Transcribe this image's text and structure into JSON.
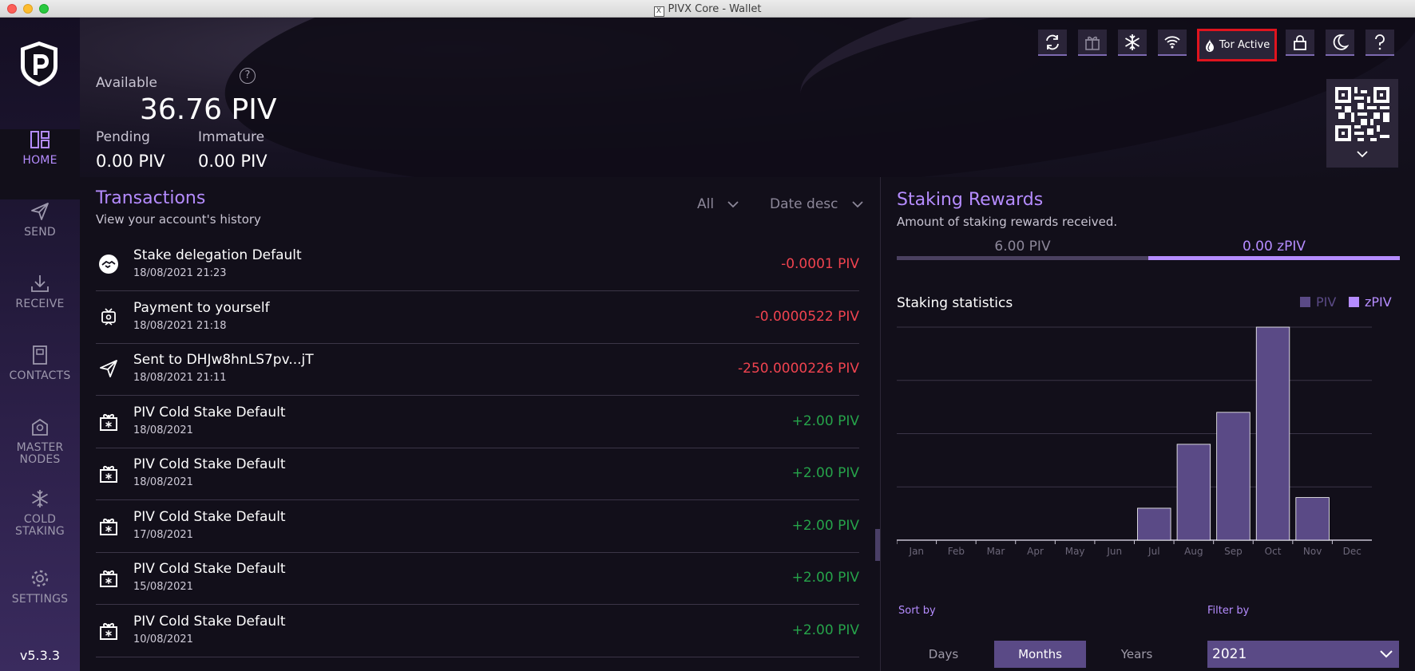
{
  "window": {
    "title": "PIVX Core - Wallet"
  },
  "sidebar": {
    "items": [
      {
        "label": "HOME",
        "icon": "dashboard-icon"
      },
      {
        "label": "SEND",
        "icon": "send-icon"
      },
      {
        "label": "RECEIVE",
        "icon": "download-icon"
      },
      {
        "label": "CONTACTS",
        "icon": "address-book-icon"
      },
      {
        "label": "MASTER\nNODES",
        "icon": "masternode-icon"
      },
      {
        "label": "COLD\nSTAKING",
        "icon": "snowflake-icon"
      },
      {
        "label": "SETTINGS",
        "icon": "gear-icon"
      }
    ],
    "version": "v5.3.3"
  },
  "balance": {
    "available_label": "Available",
    "available_value": "36.76  PIV",
    "pending_label": "Pending",
    "pending_value": "0.00 PIV",
    "immature_label": "Immature",
    "immature_value": "0.00 PIV"
  },
  "toolbar": {
    "tor_label": "Tor Active",
    "buttons": [
      "sync-icon",
      "gift-icon",
      "snowflake-icon",
      "wifi-icon",
      "tor-icon",
      "lock-icon",
      "moon-icon",
      "help-icon"
    ]
  },
  "transactions": {
    "title": "Transactions",
    "subtitle": "View your account's history",
    "filter_type": "All",
    "filter_sort": "Date desc",
    "rows": [
      {
        "title": "Stake delegation Default",
        "date": "18/08/2021 21:23",
        "amount": "-0.0001 PIV",
        "kind": "neg",
        "icon": "handshake"
      },
      {
        "title": "Payment to yourself",
        "date": "18/08/2021 21:18",
        "amount": "-0.0000522 PIV",
        "kind": "neg",
        "icon": "self"
      },
      {
        "title": "Sent to DHJw8hnLS7pv...jT",
        "date": "18/08/2021 21:11",
        "amount": "-250.0000226 PIV",
        "kind": "neg",
        "icon": "send"
      },
      {
        "title": "PIV Cold Stake Default",
        "date": "18/08/2021",
        "amount": "+2.00 PIV",
        "kind": "pos",
        "icon": "gift"
      },
      {
        "title": "PIV Cold Stake Default",
        "date": "18/08/2021",
        "amount": "+2.00 PIV",
        "kind": "pos",
        "icon": "gift"
      },
      {
        "title": "PIV Cold Stake Default",
        "date": "17/08/2021",
        "amount": "+2.00 PIV",
        "kind": "pos",
        "icon": "gift"
      },
      {
        "title": "PIV Cold Stake Default",
        "date": "15/08/2021",
        "amount": "+2.00 PIV",
        "kind": "pos",
        "icon": "gift"
      },
      {
        "title": "PIV Cold Stake Default",
        "date": "10/08/2021",
        "amount": "+2.00 PIV",
        "kind": "pos",
        "icon": "gift"
      }
    ]
  },
  "staking": {
    "title": "Staking Rewards",
    "subtitle": "Amount of staking rewards received.",
    "tab_piv": "6.00  PIV",
    "tab_zpiv": "0.00 zPIV",
    "stats_title": "Staking statistics",
    "legend_piv": "PIV",
    "legend_zpiv": "zPIV",
    "sort_by_label": "Sort by",
    "filter_by_label": "Filter by",
    "sort_options": [
      "Days",
      "Months",
      "Years"
    ],
    "sort_selected": "Months",
    "year_selected": "2021"
  },
  "colors": {
    "accent": "#b58cff",
    "bar": "#5a4a86",
    "negative": "#f0434f",
    "positive": "#26a34a",
    "tor_highlight": "#e0141e"
  },
  "chart_data": {
    "type": "bar",
    "categories": [
      "Jan",
      "Feb",
      "Mar",
      "Apr",
      "May",
      "Jun",
      "Jul",
      "Aug",
      "Sep",
      "Oct",
      "Nov",
      "Dec"
    ],
    "series": [
      {
        "name": "PIV",
        "values": [
          0,
          0,
          0,
          0,
          0,
          0,
          0.6,
          1.8,
          2.4,
          4.0,
          0.8,
          0
        ]
      }
    ],
    "ylim": [
      0,
      4
    ],
    "grid": true,
    "legend": "top-right"
  }
}
